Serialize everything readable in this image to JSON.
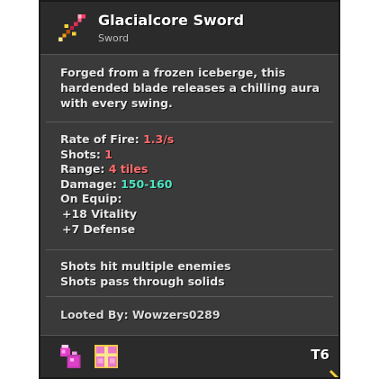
{
  "item": {
    "name": "Glacialcore Sword",
    "type": "Sword",
    "icon": "pixel-sword-icon"
  },
  "description": [
    "Forged from a frozen iceberge, this",
    "hardended blade releases a chilling aura",
    "with every swing."
  ],
  "stats": {
    "rate_of_fire_label": "Rate of Fire: ",
    "rate_of_fire_value": "1.3/s",
    "shots_label": "Shots: ",
    "shots_value": "1",
    "range_label": "Range: ",
    "range_value": "4 tiles",
    "damage_label": "Damage: ",
    "damage_value": "150-160",
    "on_equip_label": "On Equip:",
    "on_equip": [
      "+18 Vitality",
      "+7 Defense"
    ]
  },
  "effects": [
    "Shots hit multiple enemies",
    "Shots pass through solids"
  ],
  "looted_by": "Looted By: Wowzers0289",
  "footer": {
    "tier": "T6",
    "icons": [
      "potion-icon",
      "gift-box-icon"
    ]
  },
  "colors": {
    "red_value": "#ff6b6b",
    "green_value": "#4de3c0",
    "background": "#3a3a3a"
  }
}
